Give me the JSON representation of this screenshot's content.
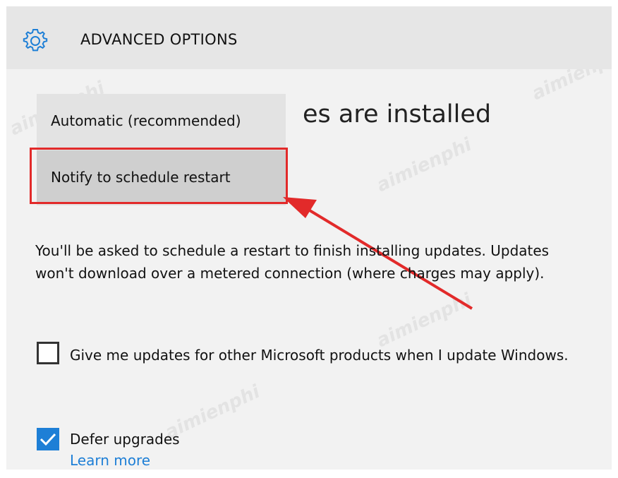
{
  "header": {
    "title": "ADVANCED OPTIONS",
    "icon": "gear-icon"
  },
  "background_heading": "es are installed",
  "dropdown": {
    "options": [
      {
        "label": "Automatic (recommended)"
      },
      {
        "label": "Notify to schedule restart"
      }
    ],
    "highlighted_index": 1
  },
  "description": "You'll be asked to schedule a restart to finish installing updates. Updates won't download over a metered connection (where charges may apply).",
  "options": {
    "other_products": {
      "label": "Give me updates for other Microsoft products when I update Windows.",
      "checked": false
    },
    "defer_upgrades": {
      "label": "Defer upgrades",
      "checked": true
    }
  },
  "learn_more": "Learn more",
  "colors": {
    "accent": "#1e7fd6",
    "annotation": "#e22a2a"
  },
  "watermark": "aimienphi"
}
